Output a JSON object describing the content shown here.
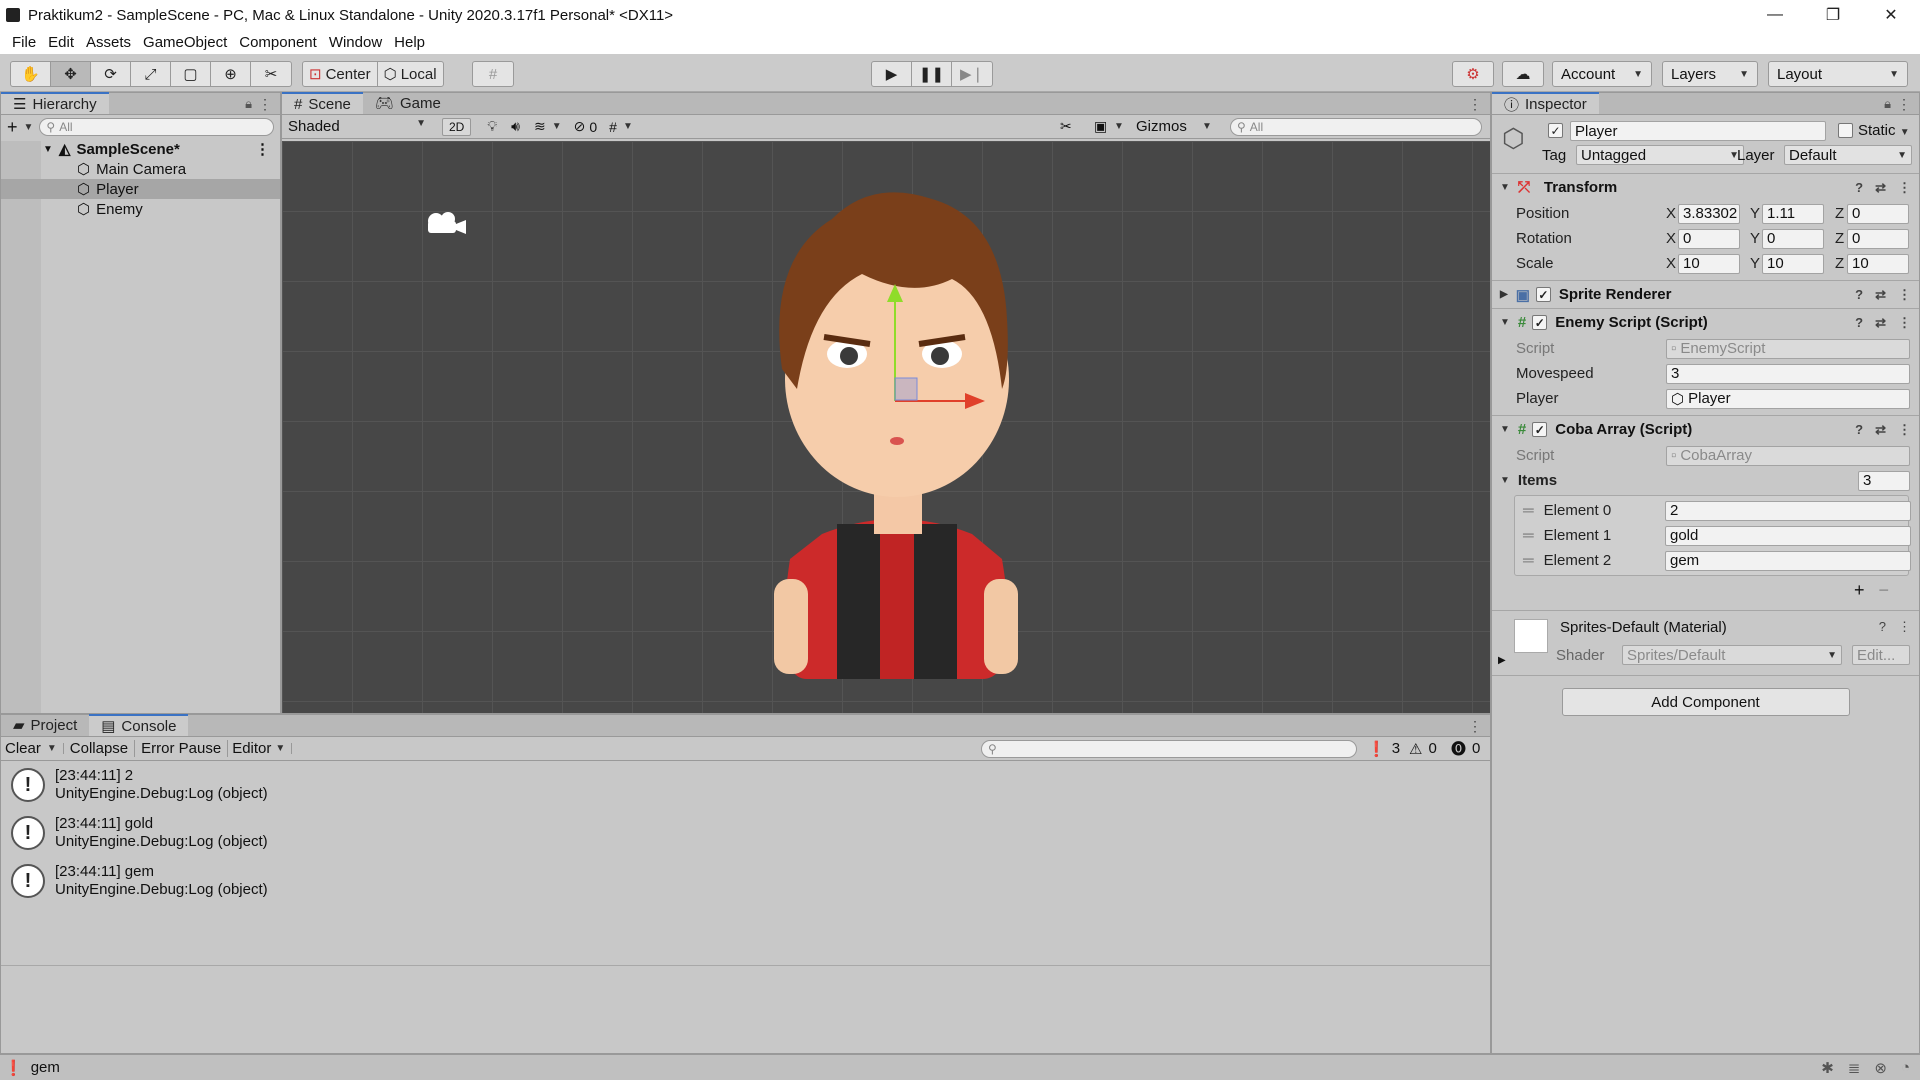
{
  "window": {
    "title": "Praktikum2 - SampleScene - PC, Mac & Linux Standalone - Unity 2020.3.17f1 Personal* <DX11>",
    "minimize": "—",
    "restore": "❐",
    "close": "✕"
  },
  "menu": [
    "File",
    "Edit",
    "Assets",
    "GameObject",
    "Component",
    "Window",
    "Help"
  ],
  "toolbar": {
    "pivot_center": "Center",
    "pivot_local": "Local",
    "account": "Account",
    "layers": "Layers",
    "layout": "Layout"
  },
  "hierarchy": {
    "tab": "Hierarchy",
    "search_placeholder": "All",
    "scene": "SampleScene*",
    "items": [
      "Main Camera",
      "Player",
      "Enemy"
    ],
    "selected_index": 1
  },
  "scene": {
    "tabs": [
      "Scene",
      "Game"
    ],
    "active_tab": "Scene",
    "shading": "Shaded",
    "mode_2d": "2D",
    "hidden_count": "0",
    "gizmos": "Gizmos",
    "search_placeholder": "All"
  },
  "inspector": {
    "tab": "Inspector",
    "object_name": "Player",
    "static_label": "Static",
    "tag_label": "Tag",
    "tag_value": "Untagged",
    "layer_label": "Layer",
    "layer_value": "Default",
    "transform": {
      "title": "Transform",
      "position_label": "Position",
      "rotation_label": "Rotation",
      "scale_label": "Scale",
      "position": {
        "x": "3.83302",
        "y": "1.11",
        "z": "0"
      },
      "rotation": {
        "x": "0",
        "y": "0",
        "z": "0"
      },
      "scale": {
        "x": "10",
        "y": "10",
        "z": "10"
      }
    },
    "sprite_renderer": {
      "title": "Sprite Renderer"
    },
    "enemy_script": {
      "title": "Enemy Script (Script)",
      "script_label": "Script",
      "script_value": "EnemyScript",
      "movespeed_label": "Movespeed",
      "movespeed_value": "3",
      "player_label": "Player",
      "player_value": "Player"
    },
    "coba_array": {
      "title": "Coba Array (Script)",
      "script_label": "Script",
      "script_value": "CobaArray",
      "items_label": "Items",
      "items_count": "3",
      "elements": [
        {
          "label": "Element 0",
          "value": "2"
        },
        {
          "label": "Element 1",
          "value": "gold"
        },
        {
          "label": "Element 2",
          "value": "gem"
        }
      ],
      "add": "+",
      "remove": "−"
    },
    "material": {
      "title": "Sprites-Default (Material)",
      "shader_label": "Shader",
      "shader_value": "Sprites/Default",
      "edit": "Edit..."
    },
    "add_component": "Add Component"
  },
  "console": {
    "tabs": [
      "Project",
      "Console"
    ],
    "active_tab": "Console",
    "clear": "Clear",
    "collapse": "Collapse",
    "error_pause": "Error Pause",
    "editor": "Editor",
    "log_count": "3",
    "warn_count": "0",
    "error_count": "0",
    "entries": [
      {
        "line1": "[23:44:11] 2",
        "line2": "UnityEngine.Debug:Log (object)"
      },
      {
        "line1": "[23:44:11] gold",
        "line2": "UnityEngine.Debug:Log (object)"
      },
      {
        "line1": "[23:44:11] gem",
        "line2": "UnityEngine.Debug:Log (object)"
      }
    ]
  },
  "status": {
    "message": "gem"
  }
}
